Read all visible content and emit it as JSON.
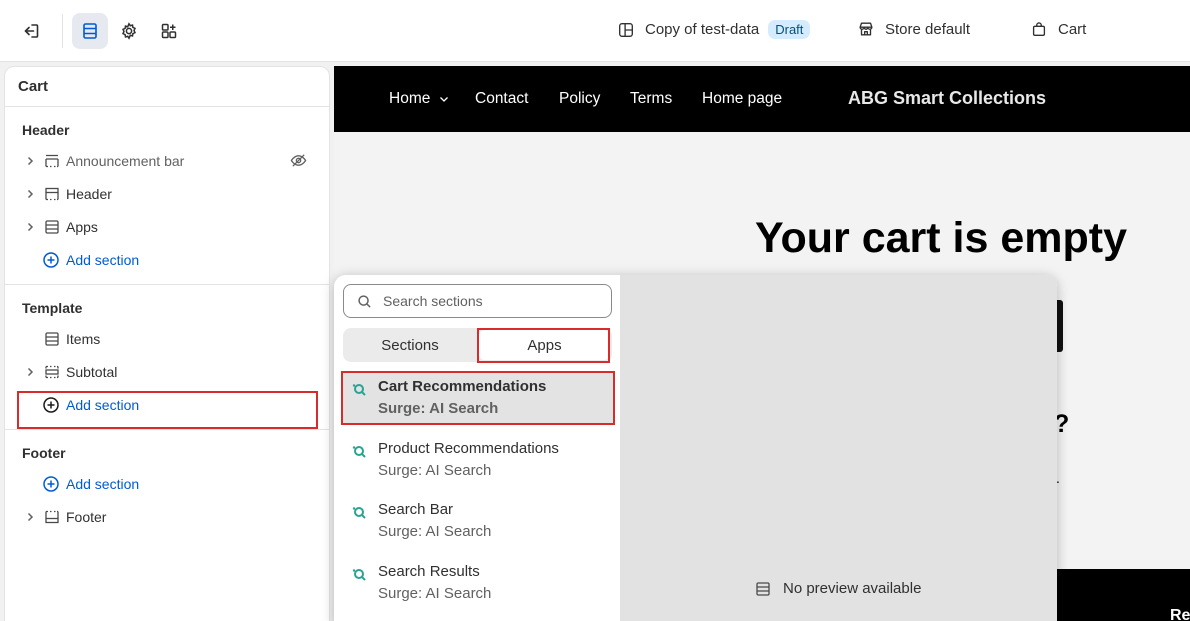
{
  "topbar": {
    "theme_name": "Copy of test-data",
    "theme_status": "Draft",
    "store": "Store default",
    "page": "Cart"
  },
  "sidebar": {
    "title": "Cart",
    "groups": [
      {
        "title": "Header",
        "items": [
          "Announcement bar",
          "Header",
          "Apps"
        ],
        "add_label": "Add section"
      },
      {
        "title": "Template",
        "items": [
          "Items",
          "Subtotal"
        ],
        "add_label": "Add section"
      },
      {
        "title": "Footer",
        "items": [
          "Footer"
        ],
        "add_label": "Add section"
      }
    ]
  },
  "storefront": {
    "nav": [
      "Home",
      "Contact",
      "Policy",
      "Terms",
      "Home page"
    ],
    "brand": "ABG Smart Collections",
    "heading": "Your cart is empty",
    "question_mark": "?",
    "dot": ".",
    "footer_text": "Re"
  },
  "picker": {
    "search_placeholder": "Search sections",
    "tabs": [
      "Sections",
      "Apps"
    ],
    "active_tab": "Apps",
    "apps": [
      {
        "name": "Cart Recommendations",
        "source": "Surge: AI Search"
      },
      {
        "name": "Product Recommendations",
        "source": "Surge: AI Search"
      },
      {
        "name": "Search Bar",
        "source": "Surge: AI Search"
      },
      {
        "name": "Search Results",
        "source": "Surge: AI Search"
      }
    ],
    "preview_message": "No preview available"
  },
  "colors": {
    "accent_link": "#005bd3",
    "highlight_box": "#d72c2c",
    "app_icon": "#29a392",
    "badge_bg": "#d5ebff"
  }
}
